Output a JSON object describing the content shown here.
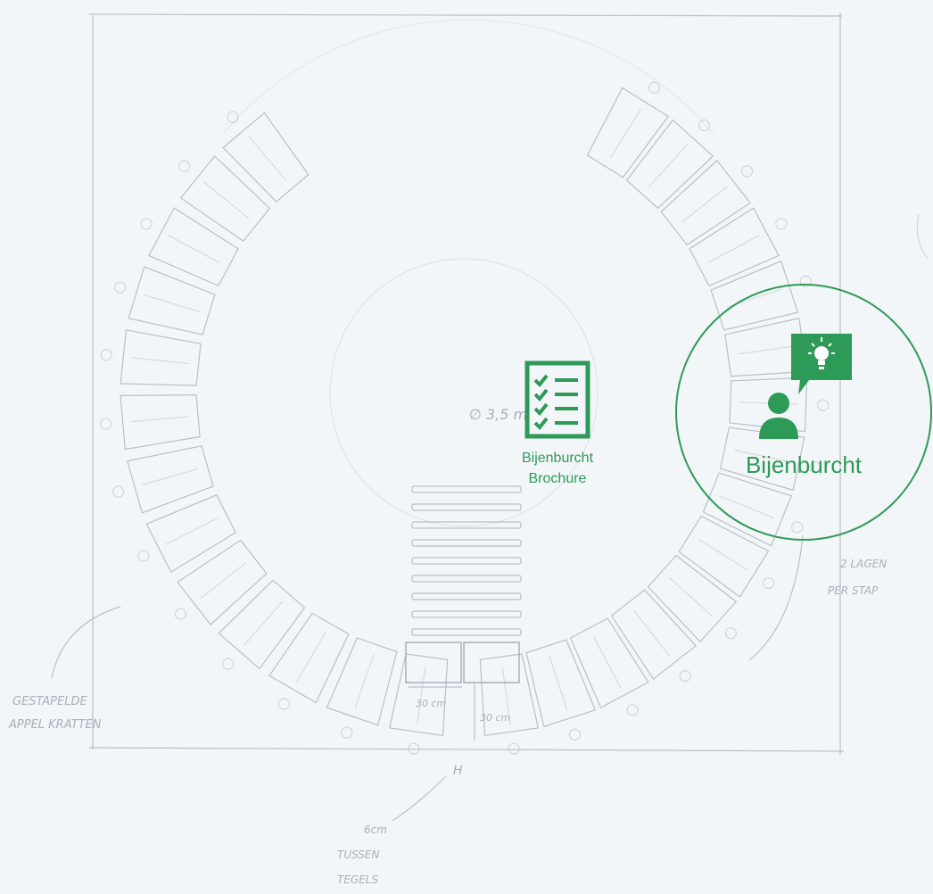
{
  "hotspots": {
    "brochure": {
      "label_line1": "Bijenburcht",
      "label_line2": "Brochure",
      "icon": "checklist-document-icon"
    },
    "bijenburcht": {
      "label": "Bijenburcht",
      "icon": "person-idea-lightbulb-icon"
    }
  },
  "sketch": {
    "annotation_left_line1": "GESTAPELDE",
    "annotation_left_line2": "APPEL KRATTEN",
    "annotation_right_line1": "2 LAGEN",
    "annotation_right_line2": "PER STAP",
    "annotation_bottom_line1": "6cm",
    "annotation_bottom_line2": "TUSSEN",
    "annotation_bottom_line3": "TEGELS",
    "diameter_label": "∅ 3,5 m",
    "dim_width": "30 cm",
    "dim_height": "30 cm",
    "marker_h": "H"
  },
  "colors": {
    "accent": "#2e9a57",
    "background": "#f3f6f9",
    "pencil": "#b9bfc6"
  }
}
